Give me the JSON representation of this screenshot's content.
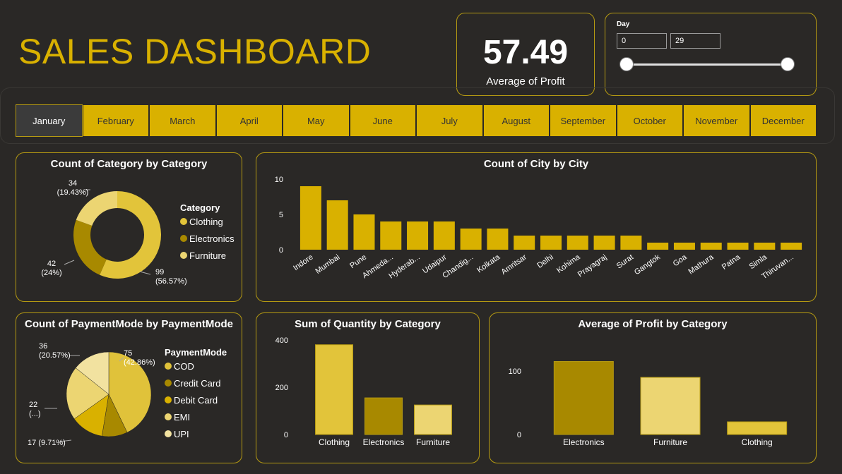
{
  "header": {
    "title": "SALES DASHBOARD"
  },
  "kpi": {
    "value": "57.49",
    "label": "Average of Profit"
  },
  "slicer": {
    "title": "Day",
    "min_value": "0",
    "max_value": "29"
  },
  "months": [
    {
      "label": "January",
      "active": true
    },
    {
      "label": "February",
      "active": false
    },
    {
      "label": "March",
      "active": false
    },
    {
      "label": "April",
      "active": false
    },
    {
      "label": "May",
      "active": false
    },
    {
      "label": "June",
      "active": false
    },
    {
      "label": "July",
      "active": false
    },
    {
      "label": "August",
      "active": false
    },
    {
      "label": "September",
      "active": false
    },
    {
      "label": "October",
      "active": false
    },
    {
      "label": "November",
      "active": false
    },
    {
      "label": "December",
      "active": false
    }
  ],
  "colors": {
    "accent": "#d9b100",
    "clothing": "#e2c43a",
    "electronics": "#a88900",
    "furniture": "#ecd572",
    "cod": "#e0c23a",
    "credit_card": "#a88900",
    "debit_card": "#d9b100",
    "emi": "#ecd572",
    "upi": "#f2e2a0",
    "bar": "#d9b100"
  },
  "chart_data": [
    {
      "type": "pie",
      "title": "Count of Category by Category",
      "legend_title": "Category",
      "categories": [
        "Clothing",
        "Electronics",
        "Furniture"
      ],
      "values": [
        99,
        42,
        34
      ],
      "labels": [
        "99\n(56.57%)",
        "42\n(24%)",
        "34\n(19.43%)"
      ],
      "donut": true,
      "legend_position": "right"
    },
    {
      "type": "bar",
      "title": "Count of City by City",
      "categories": [
        "Indore",
        "Mumbai",
        "Pune",
        "Ahmeda...",
        "Hyderab...",
        "Udaipur",
        "Chandig...",
        "Kolkata",
        "Amritsar",
        "Delhi",
        "Kohima",
        "Prayagraj",
        "Surat",
        "Gangtok",
        "Goa",
        "Mathura",
        "Patna",
        "Simla",
        "Thiruvan..."
      ],
      "values": [
        9,
        7,
        5,
        4,
        4,
        4,
        3,
        3,
        2,
        2,
        2,
        2,
        2,
        1,
        1,
        1,
        1,
        1,
        1
      ],
      "yticks": [
        "0",
        "5",
        "10"
      ],
      "ylim": [
        0,
        10
      ]
    },
    {
      "type": "pie",
      "title": "Count of PaymentMode by PaymentMode",
      "legend_title": "PaymentMode",
      "categories": [
        "COD",
        "Credit Card",
        "Debit Card",
        "EMI",
        "UPI"
      ],
      "values": [
        75,
        17,
        22,
        36,
        25
      ],
      "labels": [
        "75\n(42.86%)",
        "17 (9.71%)",
        "22\n(...)",
        "36\n(20.57%)",
        ""
      ],
      "legend_position": "right"
    },
    {
      "type": "bar",
      "title": "Sum of Quantity by Category",
      "categories": [
        "Clothing",
        "Electronics",
        "Furniture"
      ],
      "values": [
        380,
        155,
        125
      ],
      "yticks": [
        "0",
        "200",
        "400"
      ],
      "ylim": [
        0,
        400
      ]
    },
    {
      "type": "bar",
      "title": "Average of Profit by Category",
      "categories": [
        "Electronics",
        "Furniture",
        "Clothing"
      ],
      "values": [
        115,
        90,
        20
      ],
      "yticks": [
        "0",
        "100"
      ],
      "ylim": [
        0,
        100
      ]
    }
  ]
}
